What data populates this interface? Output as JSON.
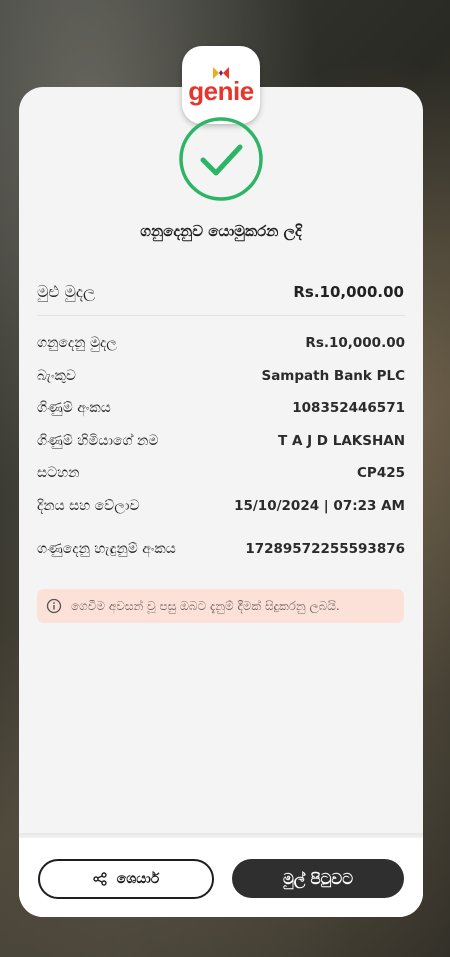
{
  "brand": {
    "logo_text": "genie"
  },
  "status": {
    "title": "ගනුදෙනුව යොමුකරන ලදි"
  },
  "total": {
    "label": "මුළු මුදල",
    "value": "Rs.10,000.00"
  },
  "details": [
    {
      "label": "ගනුදෙනු මුදල",
      "value": "Rs.10,000.00"
    },
    {
      "label": "බැංකුව",
      "value": "Sampath Bank PLC"
    },
    {
      "label": "ගිණුම් අංකය",
      "value": "108352446571"
    },
    {
      "label": "ගිණුම් හිමියාගේ නම",
      "value": "T A J D LAKSHAN"
    },
    {
      "label": "සටහන",
      "value": "CP425"
    },
    {
      "label": "දිනය සහ වේලාව",
      "value": "15/10/2024 | 07:23 AM"
    },
    {
      "label": "ගණුදෙනු හැඳුනුම් අංකය",
      "value": "17289572255593876"
    }
  ],
  "notice": {
    "text": "ගෙවීම අවසන් වූ පසු ඔබට දැනුම් දීමක් සිදුකරනු ලබයි.",
    "icon": "info-icon"
  },
  "actions": {
    "share_label": "ශෙයාර්",
    "home_label": "මුල් පිටුවට"
  },
  "colors": {
    "success": "#2db566",
    "brand": "#e8352c",
    "notice_bg": "#fbe1d8",
    "primary_button": "#2f2f2f"
  }
}
